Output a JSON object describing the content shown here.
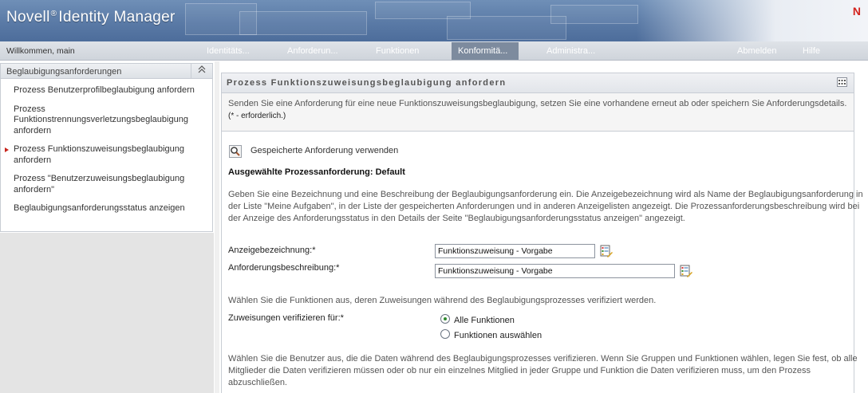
{
  "header": {
    "brand_prefix": "Novell",
    "brand_reg": "®",
    "brand_suffix": "Identity Manager",
    "logo_letter": "N"
  },
  "nav": {
    "welcome": "Willkommen, main",
    "tabs": [
      "Identitäts...",
      "Anforderun...",
      "Funktionen",
      "Konformitä...",
      "Administra..."
    ],
    "active_tab": "Konformitä...",
    "right": [
      "Abmelden",
      "Hilfe"
    ]
  },
  "sidebar": {
    "title": "Beglaubigungsanforderungen",
    "collapse_icon": "double-chevron-up",
    "items": [
      {
        "label": "Prozess Benutzerprofilbeglaubigung anfordern"
      },
      {
        "label": "Prozess Funktionstrennungsverletzungsbeglaubigung anfordern"
      },
      {
        "label": "Prozess Funktionszuweisungsbeglaubigung anfordern"
      },
      {
        "label": "Prozess \"Benutzerzuweisungsbeglaubigung anfordern\""
      },
      {
        "label": "Beglaubigungsanforderungsstatus anzeigen"
      }
    ],
    "active_index": 2
  },
  "main": {
    "title": "Prozess Funktionszuweisungsbeglaubigung anfordern",
    "description": "Senden Sie eine Anforderung für eine neue Funktionszuweisungsbeglaubigung, setzen Sie eine vorhandene erneut ab oder speichern Sie Anforderungsdetails.",
    "required_note": "(* - erforderlich.)",
    "saved_request_link": "Gespeicherte Anforderung verwenden",
    "selected_request": "Ausgewählte Prozessanforderung: Default",
    "intro_text": "Geben Sie eine Bezeichnung und eine Beschreibung der Beglaubigungsanforderung ein. Die Anzeigebezeichnung wird als Name der Beglaubigungsanforderung in der Liste \"Meine Aufgaben\", in der Liste der gespeicherten Anforderungen und in anderen Anzeigelisten angezeigt. Die Prozessanforderungsbeschreibung wird bei der Anzeige des Anforderungsstatus in den Details der Seite \"Beglaubigungsanforderungsstatus anzeigen\" angezeigt.",
    "display_label": "Anzeigebezeichnung:*",
    "display_value": "Funktionszuweisung - Vorgabe",
    "desc_label": "Anforderungsbeschreibung:*",
    "desc_value": "Funktionszuweisung - Vorgabe",
    "roles_text": "Wählen Sie die Funktionen aus, deren Zuweisungen während des Beglaubigungsprozesses verifiziert werden.",
    "verify_label": "Zuweisungen verifizieren für:*",
    "radio_all": "Alle Funktionen",
    "radio_select": "Funktionen auswählen",
    "radio_selected": "all",
    "users_text": "Wählen Sie die Benutzer aus, die die Daten während des Beglaubigungsprozesses verifizieren. Wenn Sie Gruppen und Funktionen wählen, legen Sie fest, ob alle Mitglieder die Daten verifizieren müssen oder ob nur ein einzelnes Mitglied in jeder Gruppe und Funktion die Daten verifizieren muss, um den Prozess abzuschließen."
  }
}
